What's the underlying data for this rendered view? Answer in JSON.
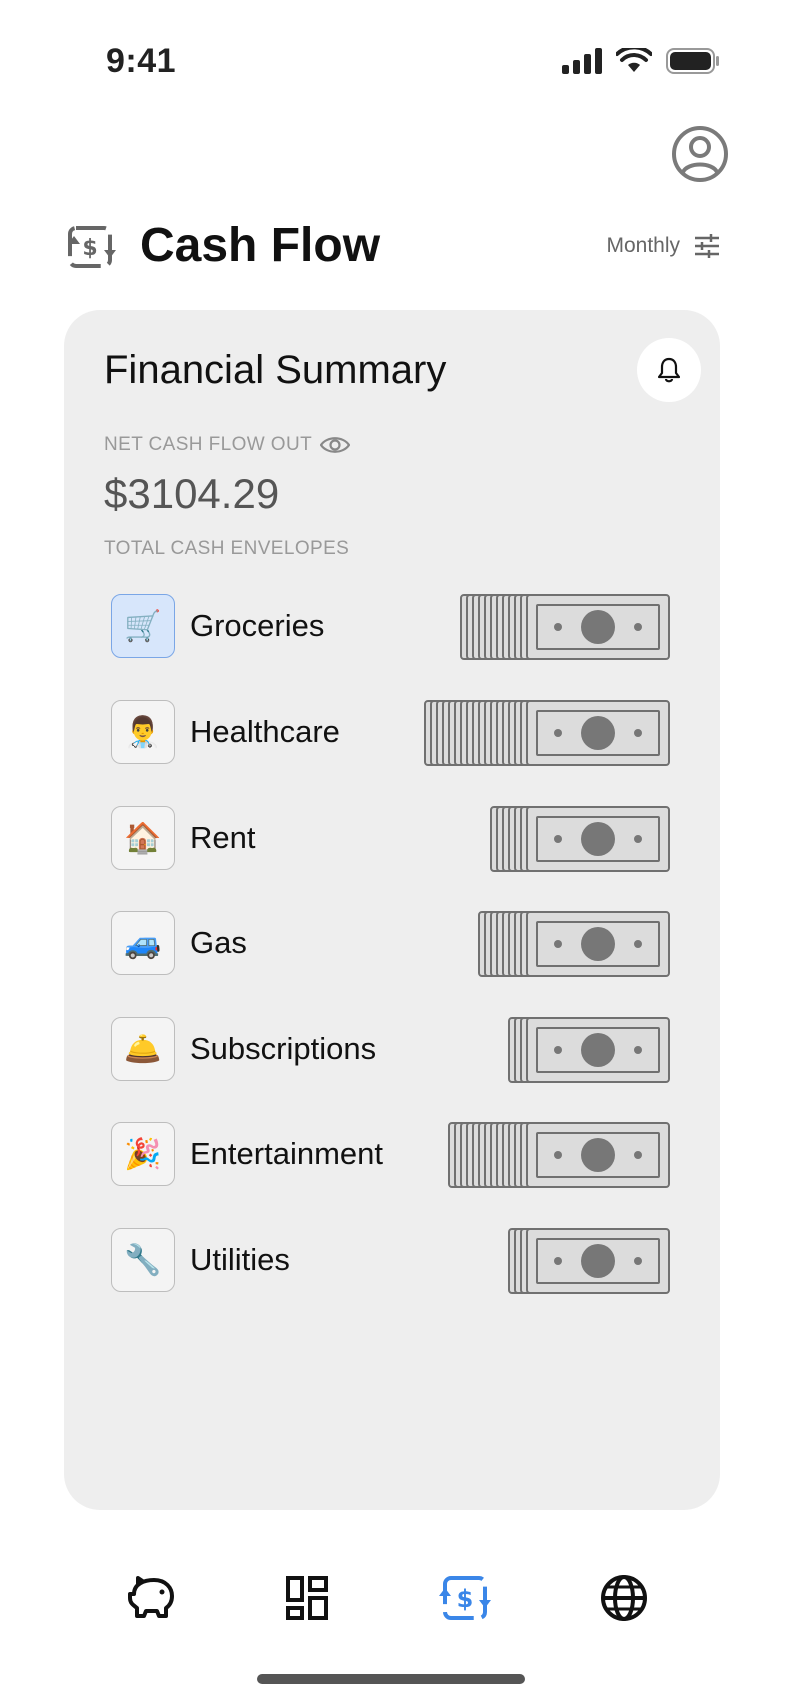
{
  "status_bar": {
    "time": "9:41"
  },
  "header": {
    "title": "Cash Flow",
    "period": "Monthly"
  },
  "summary": {
    "title": "Financial Summary",
    "net_label": "NET CASH FLOW OUT",
    "net_value": "$3104.29",
    "envelopes_label": "TOTAL CASH ENVELOPES"
  },
  "envelopes": [
    {
      "name": "Groceries",
      "emoji": "🛒",
      "bills": 12
    },
    {
      "name": "Healthcare",
      "emoji": "👨‍⚕️",
      "bills": 18
    },
    {
      "name": "Rent",
      "emoji": "🏠",
      "bills": 7
    },
    {
      "name": "Gas",
      "emoji": "🚙",
      "bills": 9
    },
    {
      "name": "Subscriptions",
      "emoji": "🛎️",
      "bills": 4
    },
    {
      "name": "Entertainment",
      "emoji": "🎉",
      "bills": 14
    },
    {
      "name": "Utilities",
      "emoji": "🔧",
      "bills": 4
    }
  ],
  "tabs": [
    {
      "name": "piggy-bank-icon",
      "active": false
    },
    {
      "name": "dashboard-icon",
      "active": false
    },
    {
      "name": "cash-flow-icon",
      "active": true
    },
    {
      "name": "globe-icon",
      "active": false
    }
  ],
  "colors": {
    "accent": "#3a86e8",
    "card": "#eeeeee",
    "bill": "#dcdcdc"
  }
}
